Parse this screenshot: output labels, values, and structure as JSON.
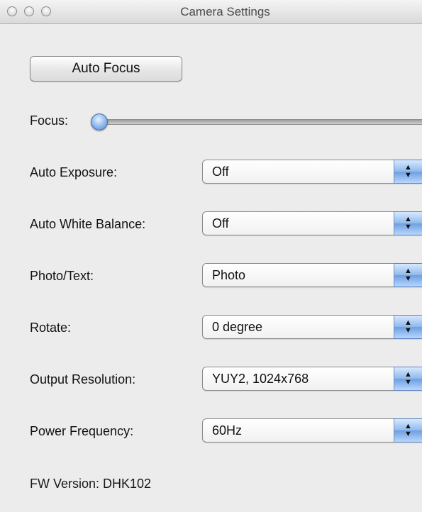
{
  "window": {
    "title": "Camera Settings"
  },
  "auto_focus_button": "Auto Focus",
  "focus": {
    "label": "Focus:",
    "slider_value_fraction": 0.0
  },
  "settings": [
    {
      "label": "Auto Exposure:",
      "value": "Off"
    },
    {
      "label": "Auto White Balance:",
      "value": "Off"
    },
    {
      "label": "Photo/Text:",
      "value": "Photo"
    },
    {
      "label": "Rotate:",
      "value": "0 degree"
    },
    {
      "label": "Output Resolution:",
      "value": "YUY2, 1024x768"
    },
    {
      "label": "Power Frequency:",
      "value": "60Hz"
    }
  ],
  "fw_version": "FW Version: DHK102",
  "icons": {
    "select_arrows": "up-down-arrows-icon",
    "traffic_lights": "window-control-icon"
  }
}
